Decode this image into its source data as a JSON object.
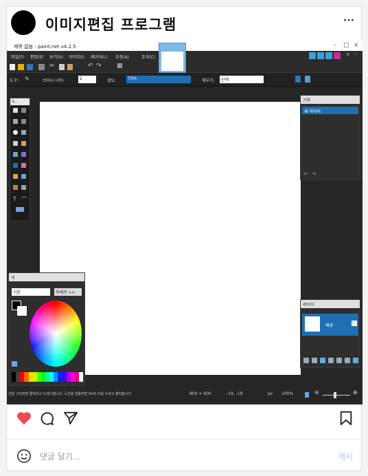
{
  "post": {
    "title": "이미지편집 프로그램",
    "more": "···",
    "comment_placeholder": "댓글 달기...",
    "post_button": "게시"
  },
  "app": {
    "window_title": "제목 없음 - paint.net v4.2.5",
    "menu": [
      "파일(F)",
      "편집(E)",
      "보기(V)",
      "이미지(I)",
      "레이어(L)",
      "조정(A)",
      "효과(C)"
    ],
    "tool_label": "도구:",
    "brush_width_label": "브러시 너비:",
    "brush_width": "2",
    "hardness_label": "경도:",
    "hardness": "75%",
    "fill_label": "채우기:",
    "fill_value": "단색",
    "history_title": "기록",
    "history_item": "새 이미지",
    "layers_title": "레이어",
    "layer_name": "배경",
    "colors_title": "색",
    "colors_primary": "기본",
    "colors_more": "자세히 >>",
    "status_text": "선을 그리려면 클릭하고 드래그합니다. 곡선을 만들려면 Shift 키를 누르고 클릭합니다.",
    "image_size": "800 × 600",
    "coords": "-19, -19",
    "unit": "px",
    "zoom": "100%"
  },
  "palette": [
    "#000000",
    "#404040",
    "#ff0000",
    "#ff6a00",
    "#ffd800",
    "#b6ff00",
    "#4cff00",
    "#00ff21",
    "#00ff90",
    "#00ffff",
    "#0094ff",
    "#0026ff",
    "#4800ff",
    "#b200ff",
    "#ff00dc",
    "#ff006e",
    "#ffffff"
  ],
  "colors": {
    "heart": "#ed4956",
    "accent": "#1f6fb2"
  }
}
